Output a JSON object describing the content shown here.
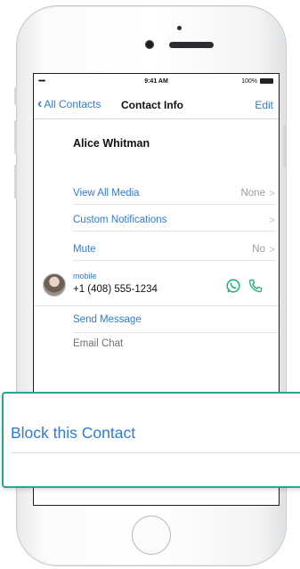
{
  "status_bar": {
    "signal": "•••••",
    "time": "9:41 AM",
    "battery": "100%"
  },
  "nav": {
    "back_label": "All Contacts",
    "title": "Contact Info",
    "edit_label": "Edit"
  },
  "contact": {
    "name": "Alice Whitman"
  },
  "settings": [
    {
      "label": "View All Media",
      "value": "None"
    },
    {
      "label": "Custom Notifications",
      "value": ""
    },
    {
      "label": "Mute",
      "value": "No"
    }
  ],
  "phone_entry": {
    "type": "mobile",
    "number": "+1 (408) 555-1234"
  },
  "actions": {
    "send_message": "Send Message",
    "email_chat": "Email Chat"
  },
  "callout": {
    "label": "Block this Contact"
  },
  "colors": {
    "accent_blue": "#2f7bdc",
    "callout_border": "#2aa58f",
    "whatsapp_green": "#2bb07a"
  },
  "icons": {
    "whatsapp": "whatsapp-icon",
    "phone": "phone-call-icon",
    "back": "chevron-left-icon",
    "disclosure": "chevron-right-icon"
  }
}
